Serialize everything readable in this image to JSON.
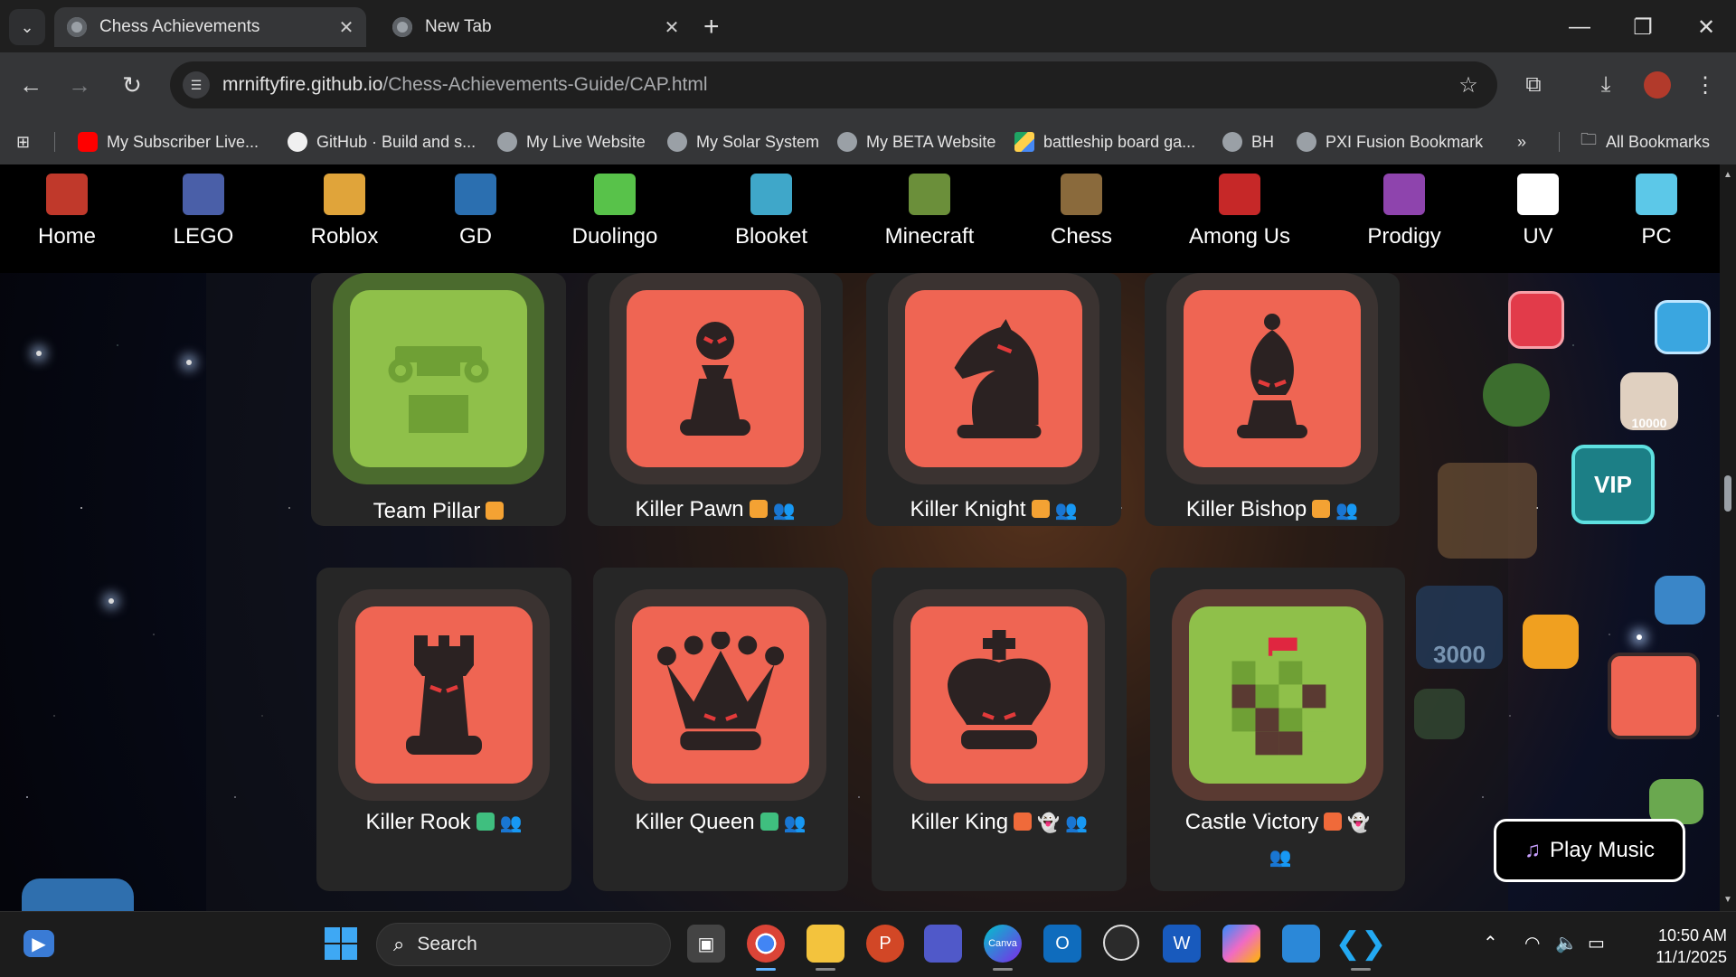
{
  "browser": {
    "tabs": [
      {
        "title": "Chess Achievements",
        "active": true
      },
      {
        "title": "New Tab",
        "active": false
      }
    ],
    "url": {
      "host": "mrniftyfire.github.io",
      "path": "/Chess-Achievements-Guide/CAP.html"
    },
    "bookmarks": [
      {
        "label": "My Subscriber Live...",
        "icon": "youtube-icon"
      },
      {
        "label": "GitHub · Build and s...",
        "icon": "github-icon"
      },
      {
        "label": "My Live Website",
        "icon": "globe-icon"
      },
      {
        "label": "My Solar System",
        "icon": "globe-icon"
      },
      {
        "label": "My BETA Website",
        "icon": "globe-icon"
      },
      {
        "label": "battleship board ga...",
        "icon": "drive-icon"
      },
      {
        "label": "BH",
        "icon": "globe-icon"
      },
      {
        "label": "PXI Fusion Bookmark",
        "icon": "globe-icon"
      }
    ],
    "bookmarks_overflow": "»",
    "all_bookmarks": "All Bookmarks"
  },
  "site_nav": [
    {
      "label": "Home",
      "color": "#c0392b"
    },
    {
      "label": "LEGO",
      "color": "#4a5fa8"
    },
    {
      "label": "Roblox",
      "color": "#e0a43a"
    },
    {
      "label": "GD",
      "color": "#2b6fb0"
    },
    {
      "label": "Duolingo",
      "color": "#58c24a"
    },
    {
      "label": "Blooket",
      "color": "#3fa7c9"
    },
    {
      "label": "Minecraft",
      "color": "#6b8f3a"
    },
    {
      "label": "Chess",
      "color": "#8a6a3c"
    },
    {
      "label": "Among Us",
      "color": "#c62828"
    },
    {
      "label": "Prodigy",
      "color": "#8e44ad"
    },
    {
      "label": "UV",
      "color": "#ffffff"
    },
    {
      "label": "PC",
      "color": "#5cc8e8"
    }
  ],
  "achievements": [
    {
      "title": "Team Pillar",
      "badges": [
        "#f4a233"
      ],
      "people": false,
      "ghost": false,
      "theme": "green",
      "piece": "pillar"
    },
    {
      "title": "Killer Pawn",
      "badges": [
        "#f4a233"
      ],
      "people": true,
      "ghost": false,
      "theme": "red",
      "piece": "pawn"
    },
    {
      "title": "Killer Knight",
      "badges": [
        "#f4a233"
      ],
      "people": true,
      "ghost": false,
      "theme": "red",
      "piece": "knight"
    },
    {
      "title": "Killer Bishop",
      "badges": [
        "#f4a233"
      ],
      "people": true,
      "ghost": false,
      "theme": "red",
      "piece": "bishop"
    },
    {
      "title": "Killer Rook",
      "badges": [
        "#3fbf7f"
      ],
      "people": true,
      "ghost": false,
      "theme": "red",
      "piece": "rook"
    },
    {
      "title": "Killer Queen",
      "badges": [
        "#3fbf7f"
      ],
      "people": true,
      "ghost": false,
      "theme": "red",
      "piece": "queen"
    },
    {
      "title": "Killer King",
      "badges": [
        "#f06a3a"
      ],
      "people": true,
      "ghost": true,
      "theme": "red",
      "piece": "king"
    },
    {
      "title": "Castle Victory",
      "badges": [
        "#f06a3a"
      ],
      "people": true,
      "ghost": true,
      "theme": "green",
      "piece": "castle"
    }
  ],
  "floating_icons": [
    "3000",
    "10000",
    "VIP"
  ],
  "play_music": "Play Music",
  "taskbar": {
    "search_label": "Search",
    "time": "10:50 AM",
    "date": "11/1/2025"
  }
}
